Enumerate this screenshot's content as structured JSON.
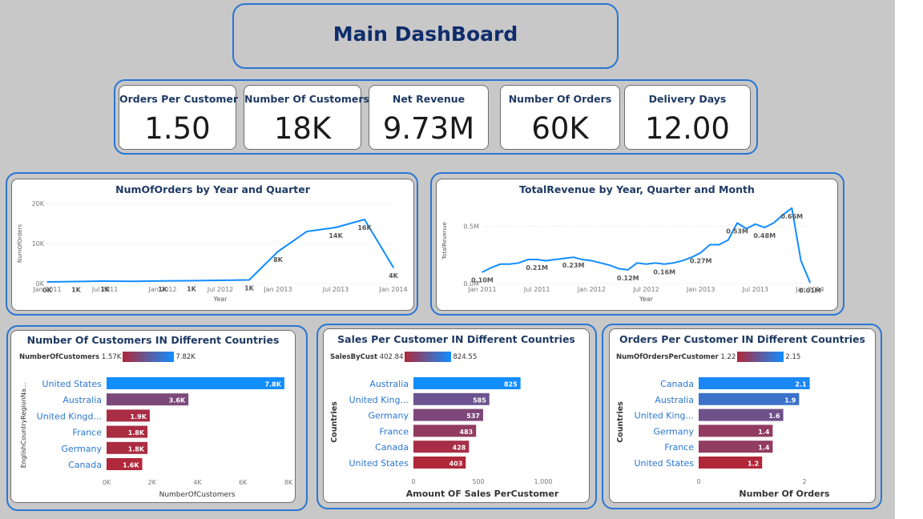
{
  "dashboard": {
    "title": "Main DashBoard"
  },
  "kpis": [
    {
      "label": "Orders Per Customer",
      "value": "1.50"
    },
    {
      "label": "Number Of Customers",
      "value": "18K"
    },
    {
      "label": "Net Revenue",
      "value": "9.73M"
    },
    {
      "label": "Number Of Orders",
      "value": "60K"
    },
    {
      "label": "Delivery Days",
      "value": "12.00"
    }
  ],
  "legends": {
    "customers": {
      "field": "NumberOfCustomers",
      "min": "1.57K",
      "max": "7.82K"
    },
    "sales": {
      "field": "SalesByCust",
      "min": "402.84",
      "max": "824.55"
    },
    "orders": {
      "field": "NumOfOrdersPerCustomer",
      "min": "1.22",
      "max": "2.15"
    }
  },
  "colors": {
    "line": "#118dff",
    "frame": "#2a76d2",
    "title": "#1f3a63",
    "bar_high": "#118dff",
    "bar_low": "#b0283a"
  },
  "chart_data": [
    {
      "type": "line",
      "title": "NumOfOrders by Year and Quarter",
      "xlabel": "Year",
      "ylabel": "NumOfOrders",
      "x_ticks": [
        "Jan 2011",
        "Jul 2011",
        "Jan 2012",
        "Jul 2012",
        "Jan 2013",
        "Jul 2013",
        "Jan 2014"
      ],
      "y_ticks": [
        "0K",
        "10K",
        "20K"
      ],
      "ylim": [
        0,
        20000
      ],
      "x": [
        "2011-01",
        "2011-04",
        "2011-07",
        "2011-10",
        "2012-01",
        "2012-04",
        "2012-07",
        "2012-10",
        "2013-01",
        "2013-04",
        "2013-07",
        "2013-10",
        "2014-01"
      ],
      "y": [
        400,
        500,
        600,
        550,
        650,
        700,
        800,
        900,
        8000,
        13000,
        14000,
        16000,
        4000
      ],
      "data_labels": [
        {
          "index": 0,
          "text": "0K"
        },
        {
          "index": 1,
          "text": "1K"
        },
        {
          "index": 2,
          "text": "1K"
        },
        {
          "index": 4,
          "text": "1K"
        },
        {
          "index": 5,
          "text": "1K"
        },
        {
          "index": 7,
          "text": "1K"
        },
        {
          "index": 8,
          "text": "8K"
        },
        {
          "index": 10,
          "text": "14K"
        },
        {
          "index": 11,
          "text": "16K"
        },
        {
          "index": 12,
          "text": "4K"
        }
      ]
    },
    {
      "type": "line",
      "title": "TotalRevenue by Year, Quarter and Month",
      "xlabel": "Year",
      "ylabel": "TotalRevenue",
      "x_ticks": [
        "Jan 2011",
        "Jul 2011",
        "Jan 2012",
        "Jul 2012",
        "Jan 2013",
        "Jul 2013",
        "Jan 2014"
      ],
      "y_ticks": [
        "0.0M",
        "0.5M"
      ],
      "ylim": [
        0,
        0.75
      ],
      "x": [
        "2011-01",
        "2011-02",
        "2011-03",
        "2011-04",
        "2011-05",
        "2011-06",
        "2011-07",
        "2011-08",
        "2011-09",
        "2011-10",
        "2011-11",
        "2011-12",
        "2012-01",
        "2012-02",
        "2012-03",
        "2012-04",
        "2012-05",
        "2012-06",
        "2012-07",
        "2012-08",
        "2012-09",
        "2012-10",
        "2012-11",
        "2012-12",
        "2013-01",
        "2013-02",
        "2013-03",
        "2013-04",
        "2013-05",
        "2013-06",
        "2013-07",
        "2013-08",
        "2013-09",
        "2013-10",
        "2013-11",
        "2013-12",
        "2014-01"
      ],
      "y": [
        0.1,
        0.14,
        0.17,
        0.17,
        0.18,
        0.21,
        0.21,
        0.2,
        0.21,
        0.22,
        0.23,
        0.21,
        0.2,
        0.18,
        0.16,
        0.13,
        0.12,
        0.18,
        0.17,
        0.18,
        0.17,
        0.18,
        0.2,
        0.23,
        0.27,
        0.34,
        0.34,
        0.38,
        0.53,
        0.48,
        0.52,
        0.49,
        0.53,
        0.6,
        0.66,
        0.2,
        0.01
      ],
      "data_labels": [
        {
          "index": 0,
          "text": "0.10M"
        },
        {
          "index": 6,
          "text": "0.21M"
        },
        {
          "index": 10,
          "text": "0.23M"
        },
        {
          "index": 16,
          "text": "0.12M"
        },
        {
          "index": 20,
          "text": "0.16M"
        },
        {
          "index": 24,
          "text": "0.27M"
        },
        {
          "index": 28,
          "text": "0.53M"
        },
        {
          "index": 31,
          "text": "0.48M"
        },
        {
          "index": 34,
          "text": "0.66M"
        },
        {
          "index": 36,
          "text": "0.01M"
        }
      ]
    },
    {
      "type": "bar",
      "title": "Number Of Customers IN Different Countries",
      "xlabel": "NumberOfCustomers",
      "ylabel": "EnglishCountryRegionNa...",
      "categories": [
        "United States",
        "Australia",
        "United Kingd...",
        "France",
        "Germany",
        "Canada"
      ],
      "values": [
        7820,
        3600,
        1900,
        1800,
        1800,
        1570
      ],
      "value_labels": [
        "7.8K",
        "3.6K",
        "1.9K",
        "1.8K",
        "1.8K",
        "1.6K"
      ],
      "x_ticks": [
        "0K",
        "2K",
        "4K",
        "6K",
        "8K"
      ],
      "xlim": [
        0,
        8000
      ],
      "color_range": [
        1570,
        7820
      ]
    },
    {
      "type": "bar",
      "title": "Sales Per Customer IN Different Countries",
      "xlabel": "Amount OF Sales PerCustomer",
      "ylabel": "Countries",
      "categories": [
        "Australia",
        "United King...",
        "Germany",
        "France",
        "Canada",
        "United States"
      ],
      "values": [
        825,
        585,
        537,
        483,
        428,
        403
      ],
      "value_labels": [
        "825",
        "585",
        "537",
        "483",
        "428",
        "403"
      ],
      "x_ticks": [
        "0",
        "500",
        "1,000"
      ],
      "xlim": [
        0,
        1000
      ],
      "color_range": [
        402.84,
        824.55
      ]
    },
    {
      "type": "bar",
      "title": "Orders Per Customer IN Different Countries",
      "xlabel": "Number Of Orders",
      "ylabel": "Countries",
      "categories": [
        "Canada",
        "Australia",
        "United King...",
        "Germany",
        "France",
        "United States"
      ],
      "values": [
        2.1,
        1.9,
        1.6,
        1.4,
        1.4,
        1.2
      ],
      "value_labels": [
        "2.1",
        "1.9",
        "1.6",
        "1.4",
        "1.4",
        "1.2"
      ],
      "x_ticks": [
        "0",
        "2"
      ],
      "xlim": [
        0,
        2.5
      ],
      "color_range": [
        1.22,
        2.15
      ]
    }
  ]
}
